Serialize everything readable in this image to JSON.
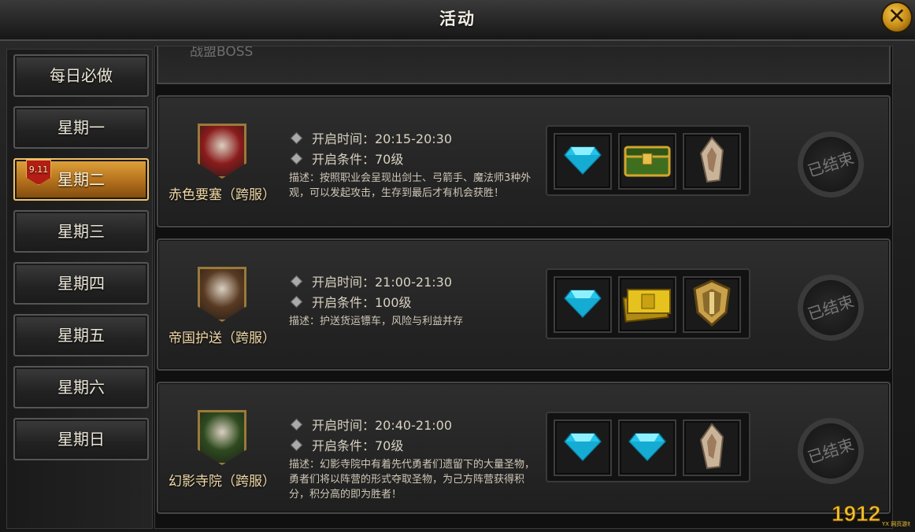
{
  "window": {
    "title": "活动",
    "close_label": "✕"
  },
  "sidebar": {
    "items": [
      {
        "label": "每日必做",
        "active": false
      },
      {
        "label": "星期一",
        "active": false
      },
      {
        "label": "星期二",
        "active": true
      },
      {
        "label": "星期三",
        "active": false
      },
      {
        "label": "星期四",
        "active": false
      },
      {
        "label": "星期五",
        "active": false
      },
      {
        "label": "星期六",
        "active": false
      },
      {
        "label": "星期日",
        "active": false
      }
    ],
    "badge": "9.11"
  },
  "partial_card": {
    "label": "战盟BOSS"
  },
  "activities": [
    {
      "name": "赤色要塞（跨服）",
      "open_time": "开启时间：20:15-20:30",
      "condition": "开启条件：70级",
      "description": "描述：按照职业会呈现出剑士、弓箭手、魔法师3种外观，可以发起攻击，生存到最后才有机会获胜！",
      "rewards": [
        "diamond-icon",
        "treasure-chest-icon",
        "scroll-icon"
      ],
      "status": "已结束",
      "emblem_color": "#8a1b1b"
    },
    {
      "name": "帝国护送（跨服）",
      "open_time": "开启时间：21:00-21:30",
      "condition": "开启条件：100级",
      "description": "描述：护送货运镖车，风险与利益并存",
      "rewards": [
        "diamond-icon",
        "gold-tickets-icon",
        "gold-shield-icon"
      ],
      "status": "已结束",
      "emblem_color": "#5a3a22"
    },
    {
      "name": "幻影寺院（跨服）",
      "open_time": "开启时间：20:40-21:00",
      "condition": "开启条件：70级",
      "description": "描述：幻影寺院中有着先代勇者们遗留下的大量圣物，勇者们将以阵营的形式夺取圣物，为己方阵营获得积分，积分高的即为胜者！",
      "rewards": [
        "diamond-icon",
        "diamond-icon",
        "scroll-icon"
      ],
      "status": "已结束",
      "emblem_color": "#2e4a1e"
    }
  ],
  "watermark": {
    "text": "1912",
    "sub": "YX 网页游戏"
  }
}
